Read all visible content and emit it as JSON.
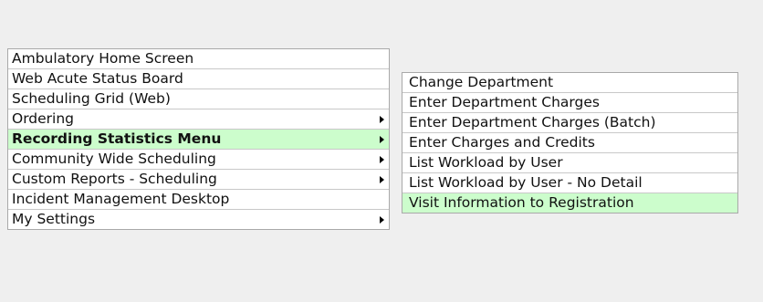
{
  "main_menu": {
    "items": [
      {
        "label": "Ambulatory Home Screen",
        "has_submenu": false,
        "selected": false
      },
      {
        "label": "Web Acute Status Board",
        "has_submenu": false,
        "selected": false
      },
      {
        "label": "Scheduling Grid (Web)",
        "has_submenu": false,
        "selected": false
      },
      {
        "label": "Ordering",
        "has_submenu": true,
        "selected": false
      },
      {
        "label": "Recording Statistics Menu",
        "has_submenu": true,
        "selected": true
      },
      {
        "label": "Community Wide Scheduling",
        "has_submenu": true,
        "selected": false
      },
      {
        "label": "Custom Reports - Scheduling",
        "has_submenu": true,
        "selected": false
      },
      {
        "label": "Incident Management Desktop",
        "has_submenu": false,
        "selected": false
      },
      {
        "label": "My Settings",
        "has_submenu": true,
        "selected": false
      }
    ]
  },
  "sub_menu": {
    "items": [
      {
        "label": "Change Department",
        "highlighted": false
      },
      {
        "label": "Enter Department Charges",
        "highlighted": false
      },
      {
        "label": "Enter Department Charges (Batch)",
        "highlighted": false
      },
      {
        "label": "Enter Charges and Credits",
        "highlighted": false
      },
      {
        "label": "List Workload by User",
        "highlighted": false
      },
      {
        "label": "List Workload by User - No Detail",
        "highlighted": false
      },
      {
        "label": "Visit Information to Registration",
        "highlighted": true
      }
    ]
  },
  "colors": {
    "background": "#efefef",
    "menu_background": "#ffffff",
    "highlight": "#ccfdcc",
    "border": "#a9a9a9"
  },
  "icons": {
    "submenu_indicator": "submenu-arrow-icon"
  }
}
